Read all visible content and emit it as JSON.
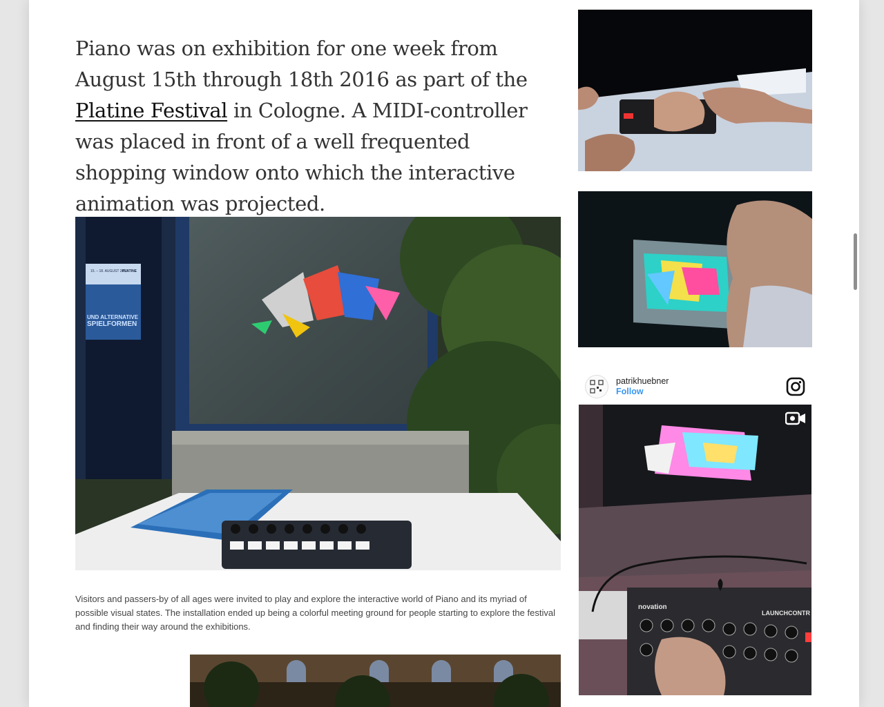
{
  "article": {
    "lead_before": "Piano was on exhibition for one week from August 15th through 18th 2016 as part of the ",
    "lead_link": "Platine Festival",
    "lead_after": " in Cologne. A MIDI-controller was placed in front of a well frequented shopping window onto which the interactive animation was projected.",
    "caption": "Visitors and passers-by of all ages were invited to play and explore the interactive world of Piano and its myriad of possible visual states. The installation ended up being a colorful meeting ground for people starting to explore the festival and finding their way around the exhibitions."
  },
  "poster": {
    "date_line": "15. – 18. AUGUST 2016",
    "brand": "PLATINE",
    "line1": "UND ALTERNATIVE",
    "line2": "SPIELFORMEN"
  },
  "instagram": {
    "username": "patrikhuebner",
    "follow_label": "Follow",
    "icons": {
      "logo": "instagram-icon",
      "video": "video-camera-icon"
    }
  },
  "device_labels": {
    "brand": "novation",
    "model": "LAUNCHCONTR"
  },
  "colors": {
    "link": "#111111",
    "follow": "#3897f0",
    "text": "#333333"
  }
}
